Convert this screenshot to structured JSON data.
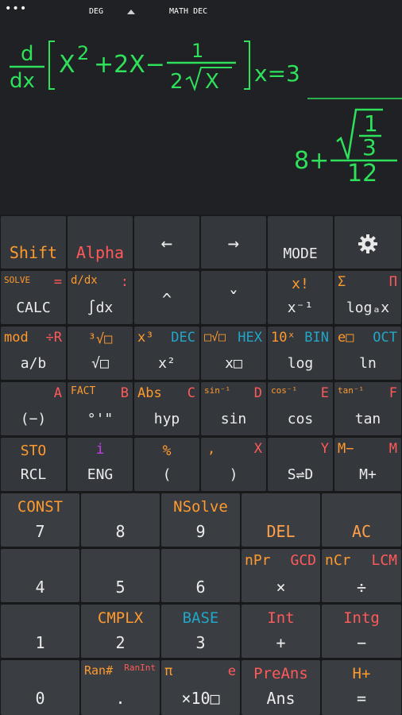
{
  "status": {
    "menu_icon": "more-dots-icon",
    "angle_mode": "DEG",
    "display_mode": "MATH DEC"
  },
  "display": {
    "input": {
      "d": "d",
      "dx": "dx",
      "X1": "X",
      "exp2": "2",
      "plus2x": "+2X−",
      "one": "1",
      "two": "2",
      "sqrtX": "X",
      "eval": "x=3"
    },
    "result": {
      "eight_plus": "8+",
      "one": "1",
      "three": "3",
      "twelve": "12"
    }
  },
  "keys": {
    "shift": "Shift",
    "alpha": "Alpha",
    "left": "←",
    "right": "→",
    "mode": "MODE",
    "settings_icon": "gear-icon",
    "calc": {
      "main": "CALC",
      "shift": "SOLVE",
      "alpha": "="
    },
    "integral": {
      "main": "∫dx",
      "shift": "d/dx",
      "alpha": ":"
    },
    "up": "^",
    "down": "ˇ",
    "inverse": {
      "main": "x⁻¹",
      "shift": "x!"
    },
    "log_a": {
      "main": "logₐx",
      "shift": "Σ",
      "alpha": "Π"
    },
    "frac": {
      "main": "a/b",
      "shift": "mod",
      "alpha": "÷R"
    },
    "sqrt": {
      "main": "√□",
      "shift": "³√□"
    },
    "square": {
      "main": "x²",
      "shift": "x³",
      "alpha": "DEC"
    },
    "power": {
      "main": "x□",
      "shift": "□√□",
      "alpha": "HEX"
    },
    "log": {
      "main": "log",
      "shift": "10ˣ",
      "alpha": "BIN"
    },
    "ln": {
      "main": "ln",
      "shift": "e□",
      "alpha": "OCT"
    },
    "neg": {
      "main": "(−)",
      "alpha": "A"
    },
    "dms": {
      "main": "°'\"",
      "shift": "FACT",
      "alpha": "B"
    },
    "hyp": {
      "main": "hyp",
      "shift": "Abs",
      "alpha": "C"
    },
    "sin": {
      "main": "sin",
      "shift": "sin⁻¹",
      "alpha": "D"
    },
    "cos": {
      "main": "cos",
      "shift": "cos⁻¹",
      "alpha": "E"
    },
    "tan": {
      "main": "tan",
      "shift": "tan⁻¹",
      "alpha": "F"
    },
    "rcl": {
      "main": "RCL",
      "shift": "STO"
    },
    "eng": {
      "main": "ENG",
      "alpha": "i"
    },
    "lparen": {
      "main": "(",
      "shift": "%"
    },
    "rparen": {
      "main": ")",
      "shift": ",",
      "alpha": "X"
    },
    "sd": {
      "main": "S⇌D",
      "alpha": "Y"
    },
    "mplus": {
      "main": "M+",
      "shift": "M−",
      "alpha": "M"
    },
    "seven": {
      "main": "7",
      "shift": "CONST"
    },
    "eight": {
      "main": "8"
    },
    "nine": {
      "main": "9",
      "shift": "NSolve"
    },
    "del": "DEL",
    "ac": "AC",
    "four": "4",
    "five": "5",
    "six": "6",
    "times": {
      "main": "×",
      "shift": "nPr",
      "alpha": "GCD"
    },
    "divide": {
      "main": "÷",
      "shift": "nCr",
      "alpha": "LCM"
    },
    "one": "1",
    "two": {
      "main": "2",
      "shift": "CMPLX"
    },
    "three": {
      "main": "3",
      "shift": "BASE"
    },
    "plus": {
      "main": "+",
      "shift": "Int"
    },
    "minus": {
      "main": "−",
      "shift": "Intg"
    },
    "zero": "0",
    "dot": {
      "main": ".",
      "shift": "Ran#",
      "alpha": "RanInt"
    },
    "exp10": {
      "main": "×10□",
      "shift": "π",
      "alpha": "e"
    },
    "ans": {
      "main": "Ans",
      "shift": "PreAns"
    },
    "equals": {
      "main": "=",
      "shift": "H+"
    }
  }
}
